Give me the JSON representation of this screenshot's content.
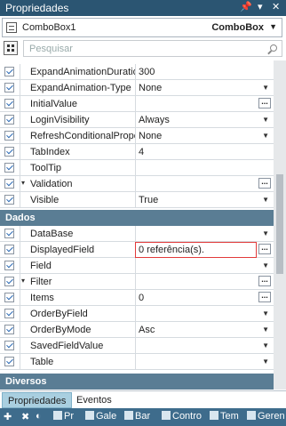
{
  "window": {
    "title": "Propriedades",
    "pin_icon": "pin-icon",
    "menu_icon": "chevron-down-icon",
    "close_icon": "close-icon"
  },
  "object_selector": {
    "name": "ComboBox1",
    "type": "ComboBox"
  },
  "search": {
    "placeholder": "Pesquisar"
  },
  "rows_top": [
    {
      "label": "ExpandAnimationDuration",
      "value": "300",
      "control": "text"
    },
    {
      "label": "ExpandAnimation-Type",
      "value": "None",
      "control": "dropdown"
    },
    {
      "label": "InitialValue",
      "value": "",
      "control": "ellipsis"
    },
    {
      "label": "LoginVisibility",
      "value": "Always",
      "control": "dropdown"
    },
    {
      "label": "RefreshConditionalPropertie",
      "value": "None",
      "control": "dropdown"
    },
    {
      "label": "TabIndex",
      "value": "4",
      "control": "text"
    },
    {
      "label": "ToolTip",
      "value": "",
      "control": "text"
    },
    {
      "label": "Validation",
      "value": "",
      "control": "ellipsis",
      "expander": "▾"
    },
    {
      "label": "Visible",
      "value": "True",
      "control": "dropdown"
    }
  ],
  "section_dados": "Dados",
  "rows_dados": [
    {
      "label": "DataBase",
      "value": "",
      "control": "dropdown"
    },
    {
      "label": "DisplayedField",
      "value": "0 referência(s).",
      "control": "ellipsis",
      "error": true
    },
    {
      "label": "Field",
      "value": "",
      "control": "dropdown"
    },
    {
      "label": "Filter",
      "value": "",
      "control": "ellipsis",
      "expander": "▾"
    },
    {
      "label": "Items",
      "value": "0",
      "control": "ellipsis"
    },
    {
      "label": "OrderByField",
      "value": "",
      "control": "dropdown"
    },
    {
      "label": "OrderByMode",
      "value": "Asc",
      "control": "dropdown"
    },
    {
      "label": "SavedFieldValue",
      "value": "",
      "control": "dropdown"
    },
    {
      "label": "Table",
      "value": "",
      "control": "dropdown"
    }
  ],
  "section_diversos": "Diversos",
  "tabs": [
    {
      "label": "Propriedades",
      "active": true
    },
    {
      "label": "Eventos",
      "active": false
    }
  ],
  "taskbar": [
    {
      "label": "Pr"
    },
    {
      "label": "Gale"
    },
    {
      "label": "Bar"
    },
    {
      "label": "Contro"
    },
    {
      "label": "Tem"
    },
    {
      "label": "Geren"
    }
  ],
  "colors": {
    "titlebar": "#2b5572",
    "section": "#5a7d94",
    "error_border": "#e23b3b",
    "active_tab": "#a9cfe0",
    "taskbar": "#3e6c8c"
  }
}
